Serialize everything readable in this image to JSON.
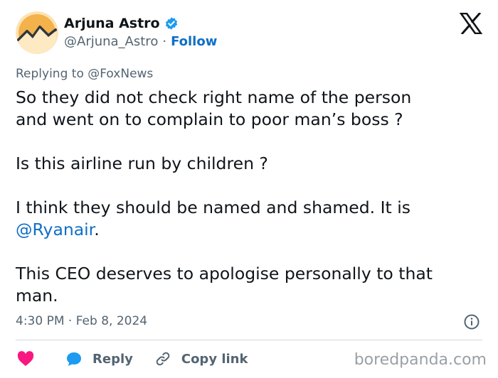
{
  "author": {
    "name": "Arjuna Astro",
    "handle": "@Arjuna_Astro",
    "separator": "·",
    "follow_label": "Follow"
  },
  "reply_context": {
    "text": "Replying to @FoxNews"
  },
  "tweet": {
    "line1": "So they did not check right name of the person",
    "line2": "and went on to complain to poor man’s boss ?",
    "line3": "Is this airline run by children ?",
    "line4": "I think they should be named and shamed. It is",
    "mention": "@Ryanair",
    "mention_suffix": ".",
    "line5": "This CEO deserves to apologise personally to that",
    "line6": "man."
  },
  "meta": {
    "timestamp": "4:30 PM · Feb 8, 2024"
  },
  "actions": {
    "reply_label": "Reply",
    "copy_link_label": "Copy link"
  },
  "watermark": {
    "text": "boredpanda.com"
  },
  "icons": {
    "verified": "verified-badge-icon",
    "x_logo": "x-logo-icon",
    "info": "info-icon",
    "like": "heart-icon",
    "reply": "reply-bubble-icon",
    "copy_link": "link-icon"
  },
  "colors": {
    "text": "#0f1419",
    "secondary": "#536471",
    "link": "#0f6fc6",
    "verified": "#1d9bf0",
    "like": "#f91880",
    "avatar_bg": "#f4c064",
    "avatar_mountain": "#2f3640"
  }
}
